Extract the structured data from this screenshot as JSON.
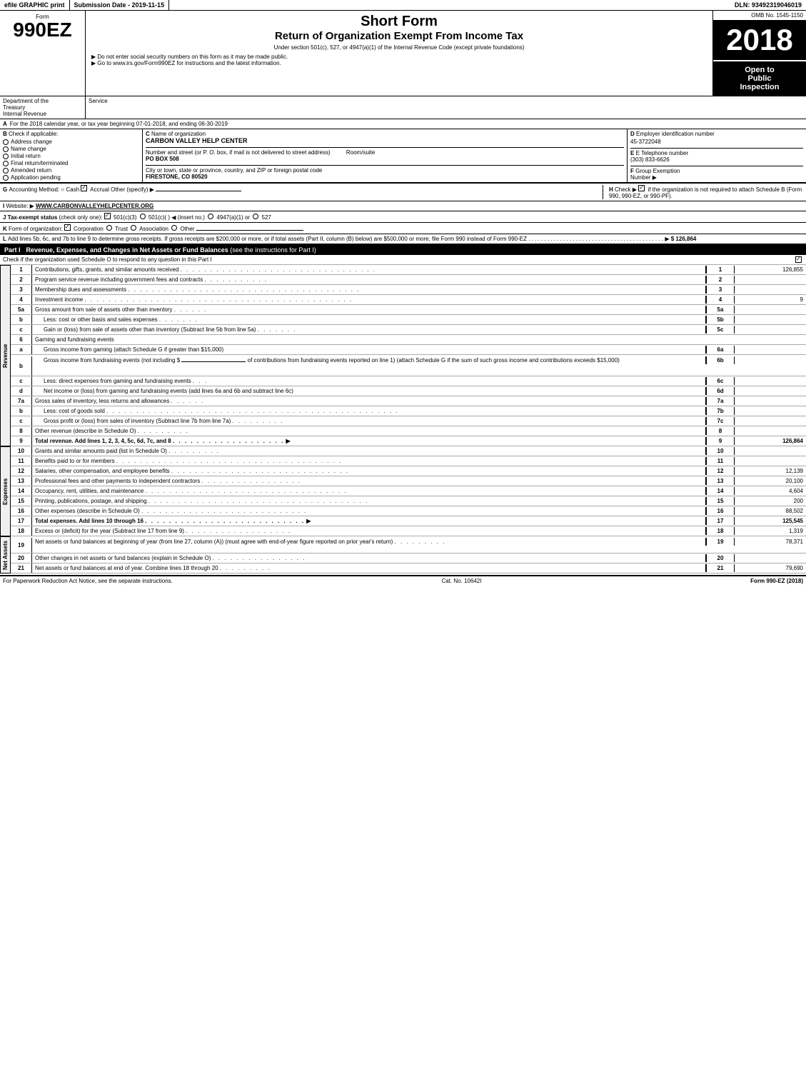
{
  "topbar": {
    "efile": "efile GRAPHIC print",
    "submission": "Submission Date - 2019-11-15",
    "dln": "DLN: 93492319046019"
  },
  "header": {
    "omb": "OMB No. 1545-1150",
    "form_label": "Form",
    "form_number": "990EZ",
    "title_main": "Short Form",
    "title_sub": "Return of Organization Exempt From Income Tax",
    "subtitle": "Under section 501(c), 527, or 4947(a)(1) of the Internal Revenue Code (except private foundations)",
    "instruction1": "▶ Do not enter social security numbers on this form as it may be made public.",
    "instruction2": "▶ Go to www.irs.gov/Form990EZ for instructions and the latest information.",
    "year": "2018",
    "open_inspection": "Open to\nPublic\nInspection"
  },
  "department": {
    "line1": "Department of the",
    "line2": "Treasury",
    "line3": "Internal Revenue"
  },
  "section_a": {
    "prefix": "A",
    "text": "For the 2018 calendar year, or tax year beginning 07-01-2018",
    "middle": ", and ending 06-30-2019"
  },
  "section_b": {
    "label": "B",
    "text": "Check if applicable:",
    "options": [
      "Address change",
      "Name change",
      "Initial return",
      "Final return/terminated",
      "Amended return",
      "Application pending"
    ]
  },
  "section_c": {
    "label": "C",
    "org_name_label": "Name of organization",
    "org_name": "CARBON VALLEY HELP CENTER",
    "addr_label": "Number and street (or P. O. box, if mail is not delivered to street address)",
    "addr": "PO BOX 508",
    "room_label": "Room/suite",
    "room": "",
    "city_label": "City or town, state or province, country, and ZIP or foreign postal code",
    "city": "FIRESTONE, CO  80520"
  },
  "section_d": {
    "label": "D",
    "ein_label": "Employer identification number",
    "ein": "45-3722048",
    "phone_label": "E Telephone number",
    "phone": "(303) 833-6626",
    "group_label": "F Group Exemption\nNumber",
    "arrow": "▶"
  },
  "section_g": {
    "label": "G",
    "text": "Accounting Method:",
    "cash": "Cash",
    "accrual": "Accrual",
    "other": "Other (specify) ▶",
    "line": "_______________"
  },
  "section_h": {
    "label": "H",
    "text": "Check ▶",
    "checkbox": "☑",
    "desc": "if the organization is not required to attach Schedule B (Form 990, 990-EZ, or 990-PF)."
  },
  "section_i": {
    "label": "I",
    "text": "Website: ▶WWW.CARBONVALLEYHELPCENTER.ORG"
  },
  "section_j": {
    "label": "J",
    "text": "Tax-exempt status",
    "note": "(check only one):",
    "options": [
      "☑ 501(c)(3)",
      "○ 501(c)(  ) ◀ (insert no.)",
      "○ 4947(a)(1) or",
      "○ 527"
    ]
  },
  "section_k": {
    "label": "K",
    "text": "Form of organization:",
    "options": [
      "☑ Corporation",
      "○ Trust",
      "○ Association",
      "○ Other"
    ],
    "line": "_______________"
  },
  "section_l": {
    "label": "L",
    "text": "Add lines 5b, 6c, and 7b to line 9 to determine gross receipts. If gross receipts are $200,000 or more, or if total assets (Part II, column (B) below) are $500,000 or more, file Form 990 instead of Form 990-EZ",
    "dots": ".............................................",
    "arrow": "▶",
    "value": "$ 126,864"
  },
  "part1": {
    "label": "Part I",
    "title": "Revenue, Expenses, and Changes in Net Assets or Fund Balances",
    "note": "(see the instructions for Part I)",
    "check_note": "Check if the organization used Schedule O to respond to any question in this Part I",
    "checkbox": "☑"
  },
  "revenue_rows": [
    {
      "num": "1",
      "desc": "Contributions, gifts, grants, and similar amounts received",
      "dots": "............................................",
      "line_ref": "1",
      "value": "126,855"
    },
    {
      "num": "2",
      "desc": "Program service revenue including government fees and contracts",
      "dots": "...........",
      "line_ref": "2",
      "value": ""
    },
    {
      "num": "3",
      "desc": "Membership dues and assessments",
      "dots": ".......................................",
      "line_ref": "3",
      "value": ""
    },
    {
      "num": "4",
      "desc": "Investment income",
      "dots": ".............................................",
      "line_ref": "4",
      "value": "9"
    }
  ],
  "row_5a": {
    "num": "5a",
    "desc": "Gross amount from sale of assets other than inventory",
    "dots": "......",
    "line_ref": "5a",
    "value": ""
  },
  "row_5b": {
    "num": "b",
    "desc": "Less: cost or other basis and sales expenses",
    "dots": ".......",
    "line_ref": "5b",
    "value": ""
  },
  "row_5c": {
    "num": "c",
    "desc": "Gain or (loss) from sale of assets other than inventory (Subtract line 5b from line 5a)",
    "dots": ".......",
    "line_ref": "5c",
    "value": ""
  },
  "row_6": {
    "num": "6",
    "desc": "Gaming and fundraising events"
  },
  "row_6a": {
    "num": "a",
    "desc": "Gross income from gaming (attach Schedule G if greater than $15,000)",
    "line_ref": "6a",
    "value": ""
  },
  "row_6b": {
    "num": "b",
    "desc": "Gross income from fundraising events (not including $",
    "desc2": "of contributions from fundraising events reported on line 1) (attach Schedule G if the sum of such gross income and contributions exceeds $15,000)",
    "line_ref": "6b",
    "value": ""
  },
  "row_6c": {
    "num": "c",
    "desc": "Less: direct expenses from gaming and fundraising events",
    "dots": "...",
    "line_ref": "6c",
    "value": ""
  },
  "row_6d": {
    "num": "d",
    "desc": "Net income or (loss) from gaming and fundraising events (add lines 6a and 6b and subtract line 6c)",
    "line_ref": "6d",
    "value": ""
  },
  "row_7a": {
    "num": "7a",
    "desc": "Gross sales of inventory, less returns and allowances",
    "dots": "......",
    "line_ref": "7a",
    "value": ""
  },
  "row_7b": {
    "num": "b",
    "desc": "Less: cost of goods sold",
    "dots": "...........",
    "line_ref": "7b",
    "value": ""
  },
  "row_7c": {
    "num": "c",
    "desc": "Gross profit or (loss) from sales of inventory (Subtract line 7b from line 7a)",
    "dots": ".........",
    "line_ref": "7c",
    "value": ""
  },
  "row_8": {
    "num": "8",
    "desc": "Other revenue (describe in Schedule O)",
    "dots": ".........",
    "line_ref": "8",
    "value": ""
  },
  "row_9": {
    "num": "9",
    "desc": "Total revenue. Add lines 1, 2, 3, 4, 5c, 6d, 7c, and 8",
    "dots": ".................",
    "arrow": "▶",
    "line_ref": "9",
    "value": "126,864"
  },
  "expense_rows": [
    {
      "num": "10",
      "desc": "Grants and similar amounts paid (list in Schedule O)",
      "dots": ".........",
      "line_ref": "10",
      "value": ""
    },
    {
      "num": "11",
      "desc": "Benefits paid to or for members",
      "dots": "...............................",
      "line_ref": "11",
      "value": ""
    },
    {
      "num": "12",
      "desc": "Salaries, other compensation, and employee benefits",
      "dots": ".............................",
      "line_ref": "12",
      "value": "12,139"
    },
    {
      "num": "13",
      "desc": "Professional fees and other payments to independent contractors",
      "dots": ".................",
      "line_ref": "13",
      "value": "20,100"
    },
    {
      "num": "14",
      "desc": "Occupancy, rent, utilities, and maintenance",
      "dots": "...............................",
      "line_ref": "14",
      "value": "4,604"
    },
    {
      "num": "15",
      "desc": "Printing, publications, postage, and shipping",
      "dots": "....................................",
      "line_ref": "15",
      "value": "200"
    },
    {
      "num": "16",
      "desc": "Other expenses (describe in Schedule O)",
      "dots": "...........................",
      "line_ref": "16",
      "value": "88,502"
    }
  ],
  "row_17": {
    "num": "17",
    "desc": "Total expenses. Add lines 10 through 16",
    "dots": "...................",
    "arrow": "▶",
    "line_ref": "17",
    "value": "125,545"
  },
  "row_18": {
    "num": "18",
    "desc": "Excess or (deficit) for the year (Subtract line 17 from line 9)",
    "dots": "..................",
    "line_ref": "18",
    "value": "1,319"
  },
  "net_asset_rows": [
    {
      "num": "19",
      "desc": "Net assets or fund balances at beginning of year (from line 27, column (A)) (must agree with end-of-year figure reported on prior year's return)",
      "dots": ".........",
      "line_ref": "19",
      "value": "78,371"
    },
    {
      "num": "20",
      "desc": "Other changes in net assets or fund balances (explain in Schedule O)",
      "dots": "...............",
      "line_ref": "20",
      "value": ""
    },
    {
      "num": "21",
      "desc": "Net assets or fund balances at end of year. Combine lines 18 through 20",
      "dots": ".........",
      "line_ref": "21",
      "value": "79,690"
    }
  ],
  "footer": {
    "paperwork": "For Paperwork Reduction Act Notice, see the separate instructions.",
    "cat": "Cat. No. 10642I",
    "form": "Form 990-EZ (2018)"
  }
}
